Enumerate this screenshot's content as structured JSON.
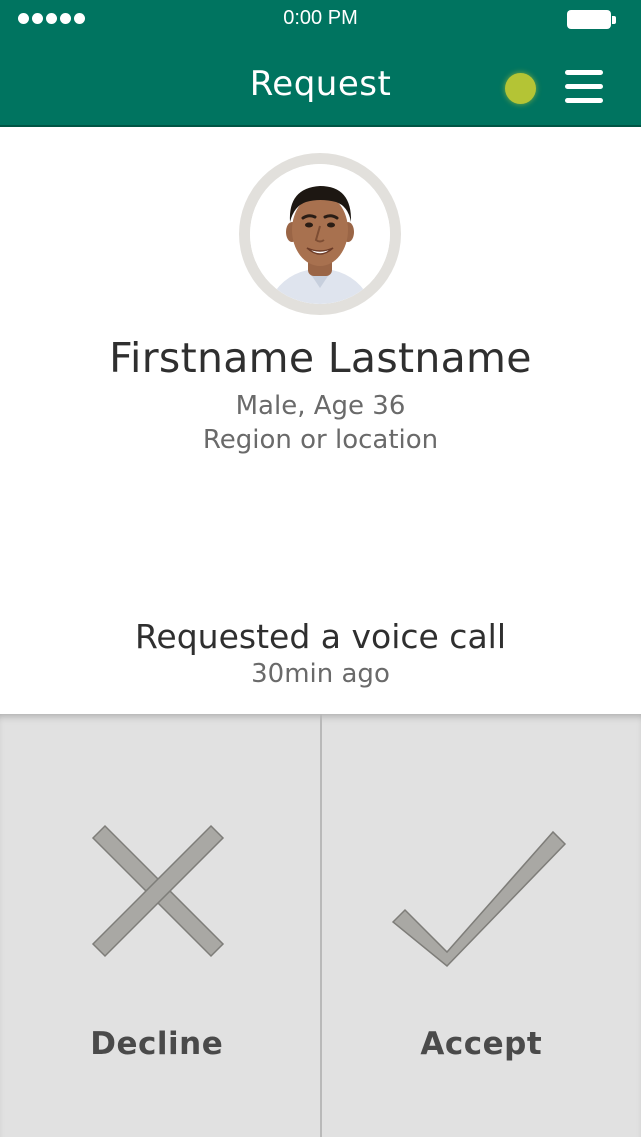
{
  "status_bar": {
    "time": "0:00 PM",
    "signal_dots": 5,
    "icons": [
      "signal-dots-icon",
      "battery-icon"
    ]
  },
  "header": {
    "title": "Request",
    "status_color": "#b4c435",
    "background_color": "#007460",
    "menu_icon": "hamburger-menu-icon"
  },
  "profile": {
    "name": "Firstname Lastname",
    "gender_age": "Male, Age 36",
    "location": "Region or location"
  },
  "request": {
    "description": "Requested a voice call",
    "time_ago": "30min ago"
  },
  "actions": {
    "decline_label": "Decline",
    "accept_label": "Accept",
    "decline_icon": "x-icon",
    "accept_icon": "checkmark-icon"
  }
}
